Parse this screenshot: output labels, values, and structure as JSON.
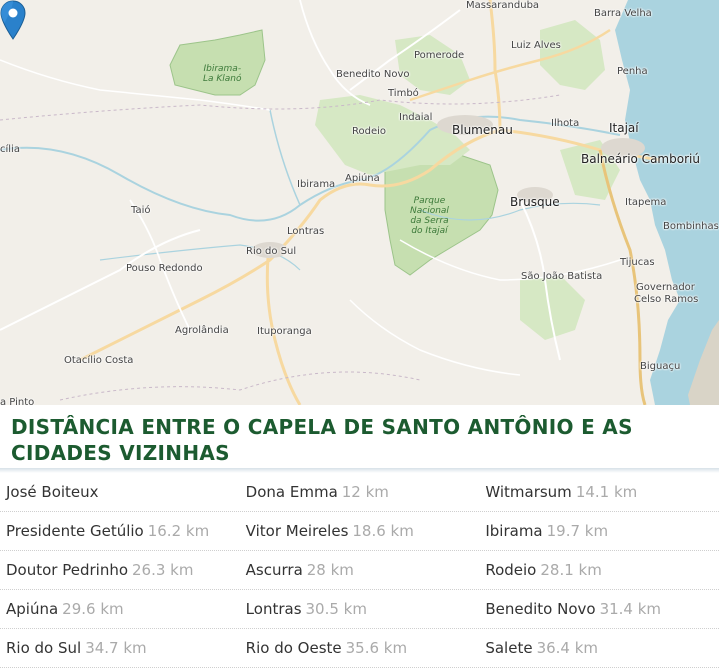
{
  "map": {
    "park_labels": [
      [
        "Ibirama-",
        "La Klanó"
      ],
      [
        "Parque",
        "Nacional",
        "da Serra",
        "do Itajaí"
      ]
    ],
    "places": [
      {
        "name": "Massaranduba",
        "big": false
      },
      {
        "name": "Barra Velha",
        "big": false
      },
      {
        "name": "Pomerode",
        "big": false
      },
      {
        "name": "Luiz Alves",
        "big": false
      },
      {
        "name": "Benedito Novo",
        "big": false
      },
      {
        "name": "Penha",
        "big": false
      },
      {
        "name": "Timbó",
        "big": false
      },
      {
        "name": "Indaial",
        "big": false
      },
      {
        "name": "Blumenau",
        "big": true
      },
      {
        "name": "Ilhota",
        "big": false
      },
      {
        "name": "Itajaí",
        "big": true
      },
      {
        "name": "Rodeio",
        "big": false
      },
      {
        "name": "Balneário Camboriú",
        "big": true
      },
      {
        "name": "cília",
        "big": false
      },
      {
        "name": "Ibirama",
        "big": false
      },
      {
        "name": "Apiúna",
        "big": false
      },
      {
        "name": "Brusque",
        "big": true
      },
      {
        "name": "Itapema",
        "big": false
      },
      {
        "name": "Taió",
        "big": false
      },
      {
        "name": "Bombinhas",
        "big": false
      },
      {
        "name": "Lontras",
        "big": false
      },
      {
        "name": "Rio do Sul",
        "big": false
      },
      {
        "name": "Tijucas",
        "big": false
      },
      {
        "name": "Pouso Redondo",
        "big": false
      },
      {
        "name": "São João Batista",
        "big": false
      },
      {
        "name": "Governador",
        "big": false
      },
      {
        "name": "Celso Ramos",
        "big": false
      },
      {
        "name": "Agrolândia",
        "big": false
      },
      {
        "name": "Ituporanga",
        "big": false
      },
      {
        "name": "Otacílio Costa",
        "big": false
      },
      {
        "name": "Biguaçu",
        "big": false
      },
      {
        "name": "a Pinto",
        "big": false
      }
    ],
    "pin_label": "map-marker-icon"
  },
  "heading": "DISTÂNCIA ENTRE O CAPELA DE SANTO ANTÔNIO E AS CIDADES VIZINHAS",
  "neighbors": [
    [
      {
        "name": "José Boiteux",
        "dist": ""
      },
      {
        "name": "Dona Emma",
        "dist": "12 km"
      },
      {
        "name": "Witmarsum",
        "dist": "14.1 km"
      }
    ],
    [
      {
        "name": "Presidente Getúlio",
        "dist": "16.2 km"
      },
      {
        "name": "Vitor Meireles",
        "dist": "18.6 km"
      },
      {
        "name": "Ibirama",
        "dist": "19.7 km"
      }
    ],
    [
      {
        "name": "Doutor Pedrinho",
        "dist": "26.3 km"
      },
      {
        "name": "Ascurra",
        "dist": "28 km"
      },
      {
        "name": "Rodeio",
        "dist": "28.1 km"
      }
    ],
    [
      {
        "name": "Apiúna",
        "dist": "29.6 km"
      },
      {
        "name": "Lontras",
        "dist": "30.5 km"
      },
      {
        "name": "Benedito Novo",
        "dist": "31.4 km"
      }
    ],
    [
      {
        "name": "Rio do Sul",
        "dist": "34.7 km"
      },
      {
        "name": "Rio do Oeste",
        "dist": "35.6 km"
      },
      {
        "name": "Salete",
        "dist": "36.4 km"
      }
    ]
  ],
  "colors": {
    "heading": "#1c5b30",
    "park": "#c6dfb0",
    "sea": "#aad3df",
    "road": "#f7d9a0"
  }
}
